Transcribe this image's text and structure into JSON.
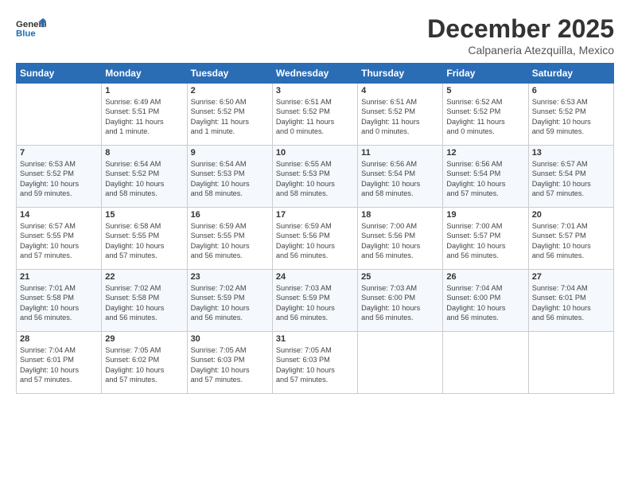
{
  "logo": {
    "line1": "General",
    "line2": "Blue"
  },
  "title": "December 2025",
  "location": "Calpaneria Atezquilla, Mexico",
  "weekdays": [
    "Sunday",
    "Monday",
    "Tuesday",
    "Wednesday",
    "Thursday",
    "Friday",
    "Saturday"
  ],
  "weeks": [
    [
      {
        "day": "",
        "text": ""
      },
      {
        "day": "1",
        "text": "Sunrise: 6:49 AM\nSunset: 5:51 PM\nDaylight: 11 hours\nand 1 minute."
      },
      {
        "day": "2",
        "text": "Sunrise: 6:50 AM\nSunset: 5:52 PM\nDaylight: 11 hours\nand 1 minute."
      },
      {
        "day": "3",
        "text": "Sunrise: 6:51 AM\nSunset: 5:52 PM\nDaylight: 11 hours\nand 0 minutes."
      },
      {
        "day": "4",
        "text": "Sunrise: 6:51 AM\nSunset: 5:52 PM\nDaylight: 11 hours\nand 0 minutes."
      },
      {
        "day": "5",
        "text": "Sunrise: 6:52 AM\nSunset: 5:52 PM\nDaylight: 11 hours\nand 0 minutes."
      },
      {
        "day": "6",
        "text": "Sunrise: 6:53 AM\nSunset: 5:52 PM\nDaylight: 10 hours\nand 59 minutes."
      }
    ],
    [
      {
        "day": "7",
        "text": "Sunrise: 6:53 AM\nSunset: 5:52 PM\nDaylight: 10 hours\nand 59 minutes."
      },
      {
        "day": "8",
        "text": "Sunrise: 6:54 AM\nSunset: 5:52 PM\nDaylight: 10 hours\nand 58 minutes."
      },
      {
        "day": "9",
        "text": "Sunrise: 6:54 AM\nSunset: 5:53 PM\nDaylight: 10 hours\nand 58 minutes."
      },
      {
        "day": "10",
        "text": "Sunrise: 6:55 AM\nSunset: 5:53 PM\nDaylight: 10 hours\nand 58 minutes."
      },
      {
        "day": "11",
        "text": "Sunrise: 6:56 AM\nSunset: 5:54 PM\nDaylight: 10 hours\nand 58 minutes."
      },
      {
        "day": "12",
        "text": "Sunrise: 6:56 AM\nSunset: 5:54 PM\nDaylight: 10 hours\nand 57 minutes."
      },
      {
        "day": "13",
        "text": "Sunrise: 6:57 AM\nSunset: 5:54 PM\nDaylight: 10 hours\nand 57 minutes."
      }
    ],
    [
      {
        "day": "14",
        "text": "Sunrise: 6:57 AM\nSunset: 5:55 PM\nDaylight: 10 hours\nand 57 minutes."
      },
      {
        "day": "15",
        "text": "Sunrise: 6:58 AM\nSunset: 5:55 PM\nDaylight: 10 hours\nand 57 minutes."
      },
      {
        "day": "16",
        "text": "Sunrise: 6:59 AM\nSunset: 5:55 PM\nDaylight: 10 hours\nand 56 minutes."
      },
      {
        "day": "17",
        "text": "Sunrise: 6:59 AM\nSunset: 5:56 PM\nDaylight: 10 hours\nand 56 minutes."
      },
      {
        "day": "18",
        "text": "Sunrise: 7:00 AM\nSunset: 5:56 PM\nDaylight: 10 hours\nand 56 minutes."
      },
      {
        "day": "19",
        "text": "Sunrise: 7:00 AM\nSunset: 5:57 PM\nDaylight: 10 hours\nand 56 minutes."
      },
      {
        "day": "20",
        "text": "Sunrise: 7:01 AM\nSunset: 5:57 PM\nDaylight: 10 hours\nand 56 minutes."
      }
    ],
    [
      {
        "day": "21",
        "text": "Sunrise: 7:01 AM\nSunset: 5:58 PM\nDaylight: 10 hours\nand 56 minutes."
      },
      {
        "day": "22",
        "text": "Sunrise: 7:02 AM\nSunset: 5:58 PM\nDaylight: 10 hours\nand 56 minutes."
      },
      {
        "day": "23",
        "text": "Sunrise: 7:02 AM\nSunset: 5:59 PM\nDaylight: 10 hours\nand 56 minutes."
      },
      {
        "day": "24",
        "text": "Sunrise: 7:03 AM\nSunset: 5:59 PM\nDaylight: 10 hours\nand 56 minutes."
      },
      {
        "day": "25",
        "text": "Sunrise: 7:03 AM\nSunset: 6:00 PM\nDaylight: 10 hours\nand 56 minutes."
      },
      {
        "day": "26",
        "text": "Sunrise: 7:04 AM\nSunset: 6:00 PM\nDaylight: 10 hours\nand 56 minutes."
      },
      {
        "day": "27",
        "text": "Sunrise: 7:04 AM\nSunset: 6:01 PM\nDaylight: 10 hours\nand 56 minutes."
      }
    ],
    [
      {
        "day": "28",
        "text": "Sunrise: 7:04 AM\nSunset: 6:01 PM\nDaylight: 10 hours\nand 57 minutes."
      },
      {
        "day": "29",
        "text": "Sunrise: 7:05 AM\nSunset: 6:02 PM\nDaylight: 10 hours\nand 57 minutes."
      },
      {
        "day": "30",
        "text": "Sunrise: 7:05 AM\nSunset: 6:03 PM\nDaylight: 10 hours\nand 57 minutes."
      },
      {
        "day": "31",
        "text": "Sunrise: 7:05 AM\nSunset: 6:03 PM\nDaylight: 10 hours\nand 57 minutes."
      },
      {
        "day": "",
        "text": ""
      },
      {
        "day": "",
        "text": ""
      },
      {
        "day": "",
        "text": ""
      }
    ]
  ]
}
